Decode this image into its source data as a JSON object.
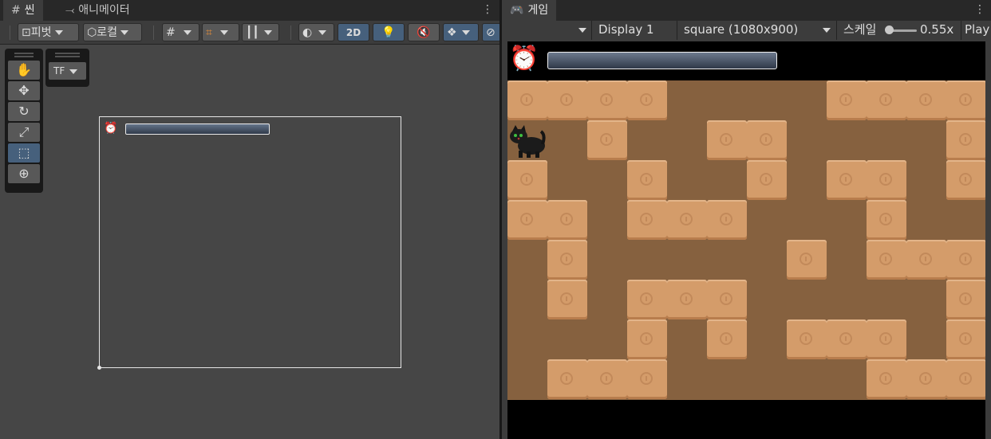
{
  "scene": {
    "tab_label": "씬",
    "tab_icon": "#",
    "animator_tab_label": "애니메이터",
    "toolbar": {
      "pivot_label": "피벗",
      "local_label": "로컬",
      "mode_2d_label": "2D"
    },
    "tf_label": "TF"
  },
  "game": {
    "tab_label": "게임",
    "display_label": "Display 1",
    "resolution_label": "square (1080x900)",
    "scale_label": "스케일",
    "scale_value": "0.55x",
    "play_label": "Play"
  },
  "maze": {
    "wall_color": "#d49c6a",
    "floor_color": "#86613f",
    "columns": 12,
    "rows": 8,
    "walls": [
      [
        0,
        0
      ],
      [
        1,
        0
      ],
      [
        2,
        0
      ],
      [
        3,
        0
      ],
      [
        8,
        0
      ],
      [
        9,
        0
      ],
      [
        10,
        0
      ],
      [
        11,
        0
      ],
      [
        2,
        1
      ],
      [
        5,
        1
      ],
      [
        6,
        1
      ],
      [
        11,
        1
      ],
      [
        0,
        2
      ],
      [
        3,
        2
      ],
      [
        6,
        2
      ],
      [
        8,
        2
      ],
      [
        9,
        2
      ],
      [
        11,
        2
      ],
      [
        0,
        3
      ],
      [
        1,
        3
      ],
      [
        3,
        3
      ],
      [
        4,
        3
      ],
      [
        5,
        3
      ],
      [
        9,
        3
      ],
      [
        1,
        4
      ],
      [
        7,
        4
      ],
      [
        9,
        4
      ],
      [
        10,
        4
      ],
      [
        11,
        4
      ],
      [
        1,
        5
      ],
      [
        3,
        5
      ],
      [
        4,
        5
      ],
      [
        5,
        5
      ],
      [
        11,
        5
      ],
      [
        3,
        6
      ],
      [
        5,
        6
      ],
      [
        7,
        6
      ],
      [
        8,
        6
      ],
      [
        9,
        6
      ],
      [
        11,
        6
      ],
      [
        1,
        7
      ],
      [
        2,
        7
      ],
      [
        3,
        7
      ],
      [
        9,
        7
      ],
      [
        10,
        7
      ],
      [
        11,
        7
      ]
    ]
  },
  "icons": {
    "clock": "alarm-clock-icon",
    "cat": "black-cat-sprite"
  }
}
